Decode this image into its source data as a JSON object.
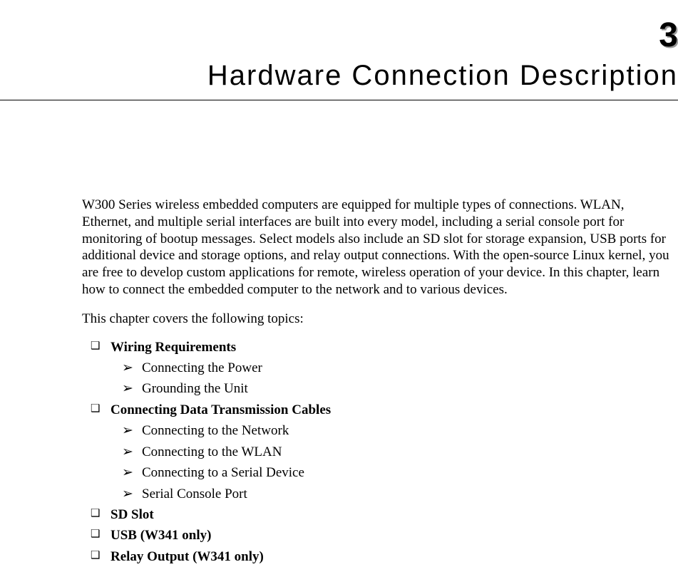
{
  "chapter_number": "3",
  "chapter_title": "Hardware Connection Description",
  "intro": "W300 Series wireless embedded computers are equipped for multiple types of connections. WLAN, Ethernet, and multiple serial interfaces are built into every model, including a serial console port for monitoring of bootup messages. Select models also include an SD slot for storage expansion, USB ports for additional device and storage options, and relay output connections. With the open-source Linux kernel, you are free to develop custom applications for remote, wireless operation of your device. In this chapter, learn how to connect the embedded computer to the network and to various devices.",
  "covers_label": "This chapter covers the following topics:",
  "topics": [
    {
      "label": "Wiring Requirements",
      "subs": [
        "Connecting the Power",
        "Grounding the Unit"
      ]
    },
    {
      "label": "Connecting Data Transmission Cables",
      "subs": [
        "Connecting to the Network",
        "Connecting to the WLAN",
        "Connecting to a Serial Device",
        "Serial Console Port"
      ]
    },
    {
      "label": "SD Slot",
      "subs": []
    },
    {
      "label": "USB (W341 only)",
      "subs": []
    },
    {
      "label": "Relay Output (W341 only)",
      "subs": []
    }
  ]
}
